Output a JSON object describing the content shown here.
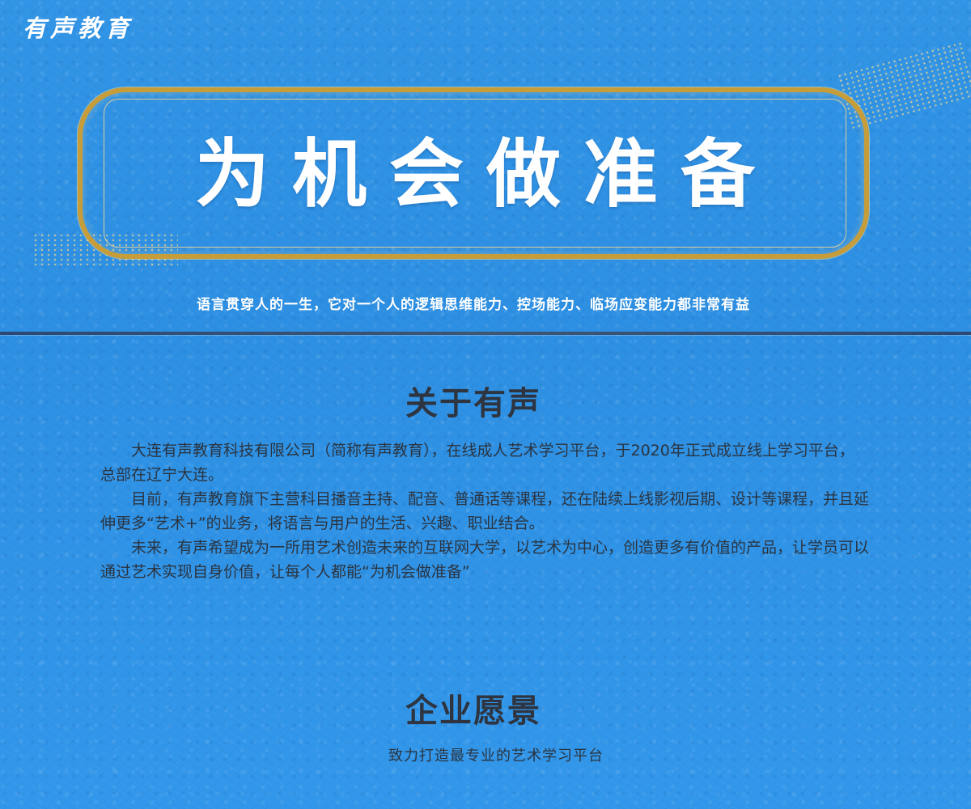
{
  "brand": {
    "name": "有声教育"
  },
  "hero": {
    "title": "为机会做准备",
    "tagline": "语言贯穿人的一生，它对一个人的逻辑思维能力、控场能力、临场应变能力都非常有益"
  },
  "about": {
    "heading": "关于有声",
    "paragraphs": [
      "大连有声教育科技有限公司（简称有声教育），在线成人艺术学习平台，于2020年正式成立线上学习平台，总部在辽宁大连。",
      "目前，有声教育旗下主营科目播音主持、配音、普通话等课程，还在陆续上线影视后期、设计等课程，并且延伸更多“艺术+”的业务，将语言与用户的生活、兴趣、职业结合。",
      "未来，有声希望成为一所用艺术创造未来的互联网大学，以艺术为中心，创造更多有价值的产品，让学员可以通过艺术实现自身价值，让每个人都能“为机会做准备”"
    ]
  },
  "vision": {
    "heading": "企业愿景",
    "text": "致力打造最专业的艺术学习平台"
  },
  "colors": {
    "background": "#2f93e6",
    "gold_frame": "#c79d3a",
    "heading_text": "#2e3540",
    "body_text": "#2b3440",
    "hero_text": "#ffffff"
  }
}
